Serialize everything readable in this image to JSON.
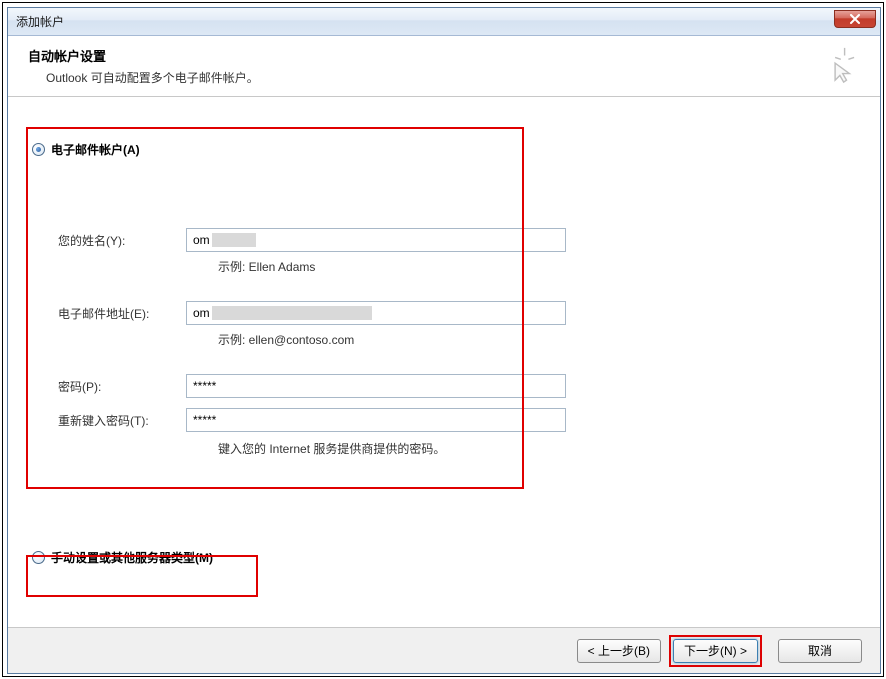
{
  "window": {
    "title": "添加帐户"
  },
  "header": {
    "title": "自动帐户设置",
    "subtitle": "Outlook 可自动配置多个电子邮件帐户。"
  },
  "options": {
    "email_account_label": "电子邮件帐户(A)",
    "manual_label": "手动设置或其他服务器类型(M)"
  },
  "form": {
    "name_label": "您的姓名(Y):",
    "name_value": "om",
    "name_example": "示例: Ellen Adams",
    "email_label": "电子邮件地址(E):",
    "email_value": "om",
    "email_example": "示例: ellen@contoso.com",
    "password_label": "密码(P):",
    "password_value": "*****",
    "retype_label": "重新键入密码(T):",
    "retype_value": "*****",
    "password_hint": "键入您的 Internet 服务提供商提供的密码。"
  },
  "buttons": {
    "back": "< 上一步(B)",
    "next": "下一步(N) >",
    "cancel": "取消"
  }
}
